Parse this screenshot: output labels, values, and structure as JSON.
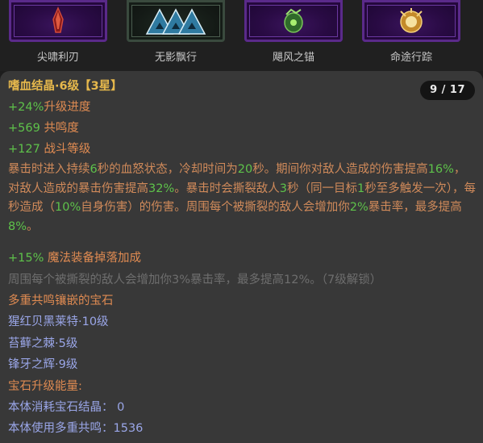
{
  "skills": [
    {
      "label": "尖啸利刃",
      "icon": "crimson-blade-icon"
    },
    {
      "label": "无影飘行",
      "icon": "blue-triangles-icon"
    },
    {
      "label": "飓风之锚",
      "icon": "green-anchor-icon"
    },
    {
      "label": "命途行踪",
      "icon": "golden-orb-icon"
    }
  ],
  "page_indicator": "9 / 17",
  "item": {
    "title": "嗜血结晶·6级【3星】",
    "stats": [
      {
        "value": "+24%",
        "label": "升级进度"
      },
      {
        "value": "+569",
        "label": "共鸣度"
      },
      {
        "value": "+127",
        "label": "战斗等级"
      }
    ],
    "description": [
      {
        "t": "暴击时进入持续"
      },
      {
        "t": "6",
        "hl": true
      },
      {
        "t": "秒的血怒状态，冷却时间为"
      },
      {
        "t": "20",
        "hl": true
      },
      {
        "t": "秒。期间你对敌人造成的伤害提高"
      },
      {
        "t": "16%",
        "hl": true
      },
      {
        "t": "，对敌人造成的暴击伤害提高"
      },
      {
        "t": "32%",
        "hl": true
      },
      {
        "t": "。暴击时会撕裂敌人"
      },
      {
        "t": "3",
        "hl": true
      },
      {
        "t": "秒（同一目标"
      },
      {
        "t": "1",
        "hl": true
      },
      {
        "t": "秒至多触发一次），每秒造成（"
      },
      {
        "t": "10%",
        "hl": true
      },
      {
        "t": "自身伤害）的伤害。周围每个被撕裂的敌人会增加你"
      },
      {
        "t": "2%",
        "hl": true
      },
      {
        "t": "暴击率，最多提高"
      },
      {
        "t": "8%",
        "hl": true
      },
      {
        "t": "。"
      }
    ],
    "bonus": {
      "value": "+15%",
      "label": "魔法装备掉落加成"
    },
    "locked_effect": "周围每个被撕裂的敌人会增加你3%暴击率，最多提高12%。（7级解锁）",
    "socket_header": "多重共鸣镶嵌的宝石",
    "gems": [
      "猩红贝黑莱特·10级",
      "苔藓之棘·5级",
      "锋牙之辉·9级"
    ],
    "upgrade_energy_label": "宝石升级能量:",
    "consume_label": "本体消耗宝石结晶：",
    "consume_value": "0",
    "resonance_label": "本体使用多重共鸣：",
    "resonance_value": "1536"
  }
}
